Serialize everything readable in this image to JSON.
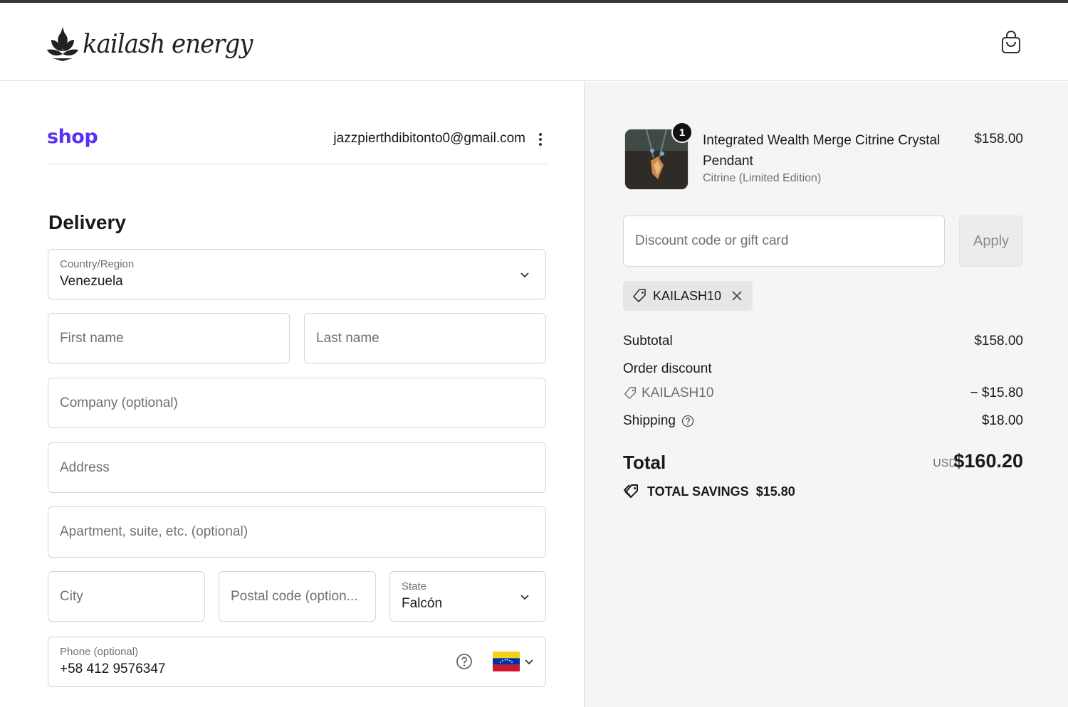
{
  "header": {
    "brand": "kailash energy",
    "cart_icon": "shopping-bag-icon"
  },
  "account": {
    "shop_logo": "shop",
    "email": "jazzpierthdibitonto0@gmail.com",
    "menu_icon": "kebab-menu-icon"
  },
  "delivery": {
    "title": "Delivery",
    "country_label": "Country/Region",
    "country_value": "Venezuela",
    "first_name_placeholder": "First name",
    "last_name_placeholder": "Last name",
    "company_placeholder": "Company (optional)",
    "address_placeholder": "Address",
    "apartment_placeholder": "Apartment, suite, etc. (optional)",
    "city_placeholder": "City",
    "postal_placeholder": "Postal code (option...",
    "state_label": "State",
    "state_value": "Falcón",
    "phone_label": "Phone (optional)",
    "phone_value": "+58 412 9576347"
  },
  "summary": {
    "item": {
      "quantity": "1",
      "name": "Integrated Wealth Merge Citrine Crystal Pendant",
      "variant": "Citrine (Limited Edition)",
      "price": "$158.00"
    },
    "discount_placeholder": "Discount code or gift card",
    "apply_label": "Apply",
    "applied_code": "KAILASH10",
    "subtotal_label": "Subtotal",
    "subtotal_value": "$158.00",
    "order_discount_label": "Order discount",
    "discount_code": "KAILASH10",
    "discount_value": "− $15.80",
    "shipping_label": "Shipping",
    "shipping_value": "$18.00",
    "total_label": "Total",
    "currency": "USD",
    "total_value": "$160.20",
    "savings_label": "TOTAL SAVINGS",
    "savings_value": "$15.80"
  },
  "colors": {
    "shop_purple": "#5a31f4",
    "right_panel_bg": "#f5f5f5",
    "top_bar": "#3d3530"
  }
}
